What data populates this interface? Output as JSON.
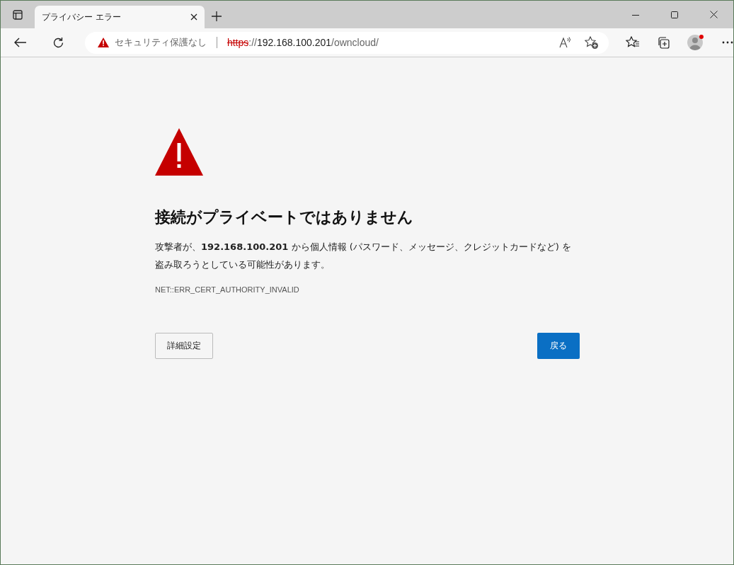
{
  "window": {
    "tabs": [
      {
        "title": "プライバシー エラー"
      }
    ]
  },
  "address_bar": {
    "security_label": "セキュリティ保護なし",
    "url_scheme": "https",
    "url_separator": "://",
    "url_host": "192.168.100.201",
    "url_path": "/owncloud/"
  },
  "profile": {
    "notification": true
  },
  "error_page": {
    "heading": "接続がプライベートではありません",
    "message": "攻撃者が、**192.168.100.201** から個人情報 (パスワード、メッセージ、クレジットカードなど) を盗み取ろうとしている可能性があります。",
    "error_code": "NET::ERR_CERT_AUTHORITY_INVALID",
    "buttons": [
      {
        "label": "詳細設定",
        "kind": "secondary"
      },
      {
        "label": "戻る",
        "kind": "primary"
      }
    ]
  }
}
